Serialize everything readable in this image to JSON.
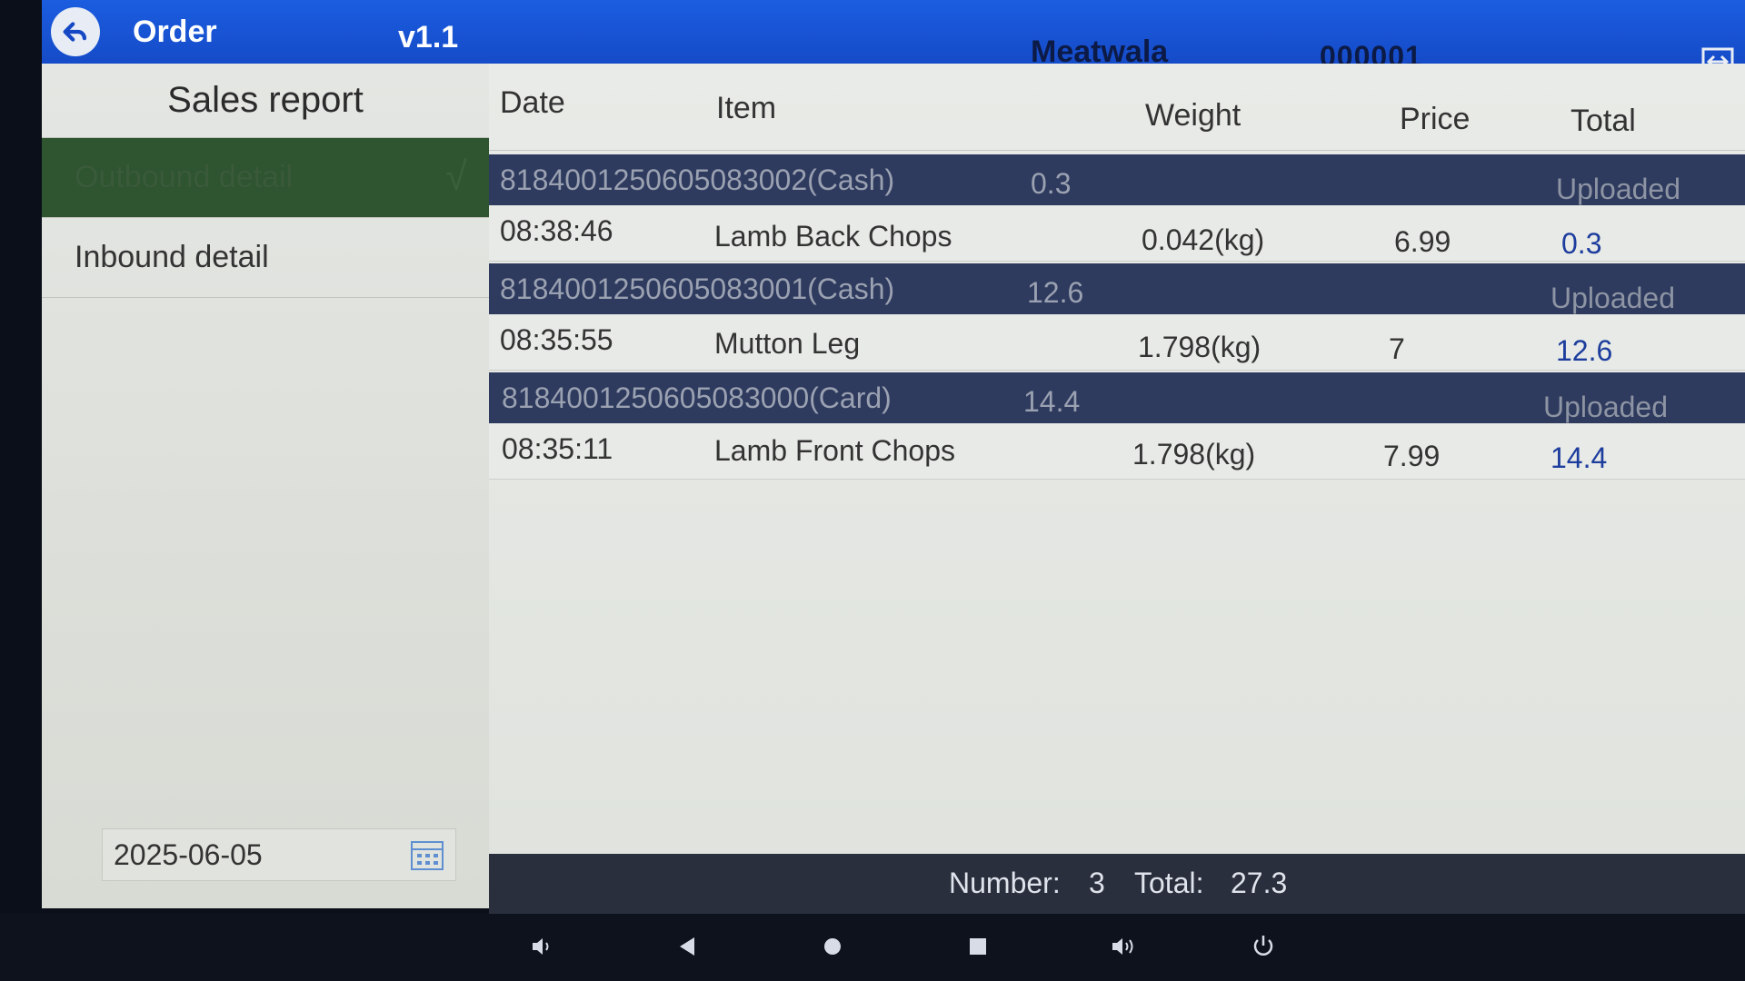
{
  "header": {
    "title": "Order",
    "version": "v1.1",
    "store": "Meatwala",
    "device_id": "000001"
  },
  "sidebar": {
    "heading": "Sales report",
    "items": [
      {
        "label": "Outbound detail",
        "active": true
      },
      {
        "label": "Inbound detail",
        "active": false
      }
    ],
    "date": "2025-06-05"
  },
  "table": {
    "columns": [
      "Date",
      "Item",
      "Weight",
      "Price",
      "Total"
    ],
    "orders": [
      {
        "order_no": "818400125060508300​2(Cash)",
        "amount": "0.3",
        "status": "Uploaded",
        "item": {
          "time": "08:38:46",
          "name": "Lamb Back Chops",
          "weight": "0.042(kg)",
          "price": "6.99",
          "total": "0.3"
        }
      },
      {
        "order_no": "8184001250605083001(Cash)",
        "amount": "12.6",
        "status": "Uploaded",
        "item": {
          "time": "08:35:55",
          "name": "Mutton Leg",
          "weight": "1.798(kg)",
          "price": "7",
          "total": "12.6"
        }
      },
      {
        "order_no": "8184001250605083000(Card)",
        "amount": "14.4",
        "status": "Uploaded",
        "item": {
          "time": "08:35:11",
          "name": "Lamb Front Chops",
          "weight": "1.798(kg)",
          "price": "7.99",
          "total": "14.4"
        }
      }
    ]
  },
  "summary": {
    "number_label": "Number:",
    "number_value": "3",
    "total_label": "Total:",
    "total_value": "27.3"
  },
  "navbar": [
    "volume-down-icon",
    "back-triangle-icon",
    "home-circle-icon",
    "recents-square-icon",
    "volume-up-icon",
    "power-icon"
  ],
  "colors": {
    "header_blue": "#1448c4",
    "order_row": "#2e3a5e",
    "active_item": "#2e5430",
    "value_blue": "#1d3d9e"
  }
}
